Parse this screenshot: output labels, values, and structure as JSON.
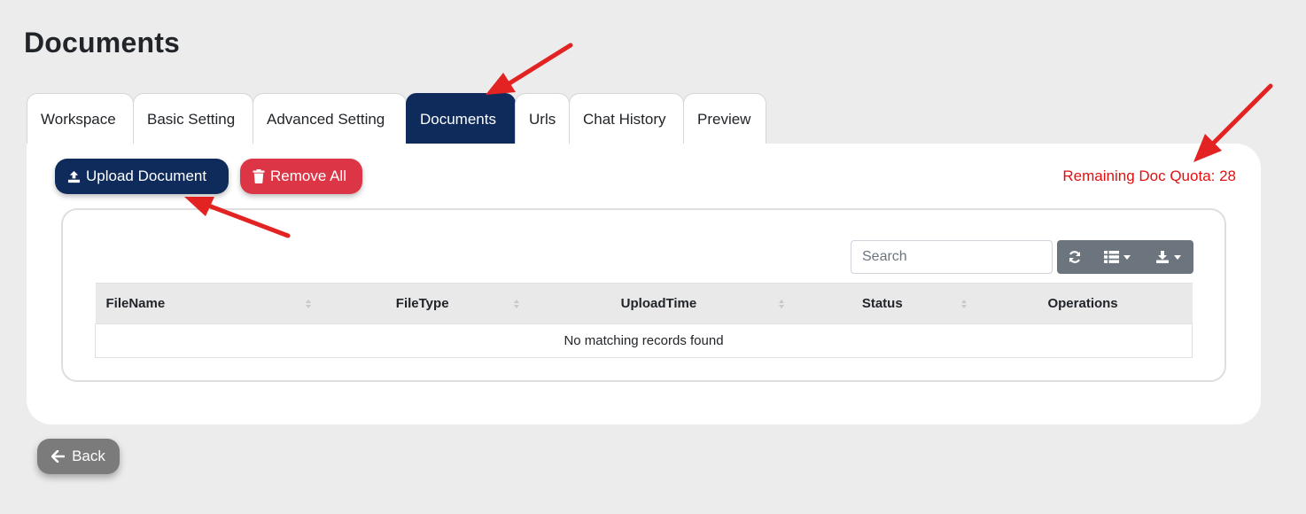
{
  "page": {
    "title": "Documents"
  },
  "tabs": [
    {
      "label": "Workspace",
      "active": false
    },
    {
      "label": "Basic Setting",
      "active": false
    },
    {
      "label": "Advanced Setting",
      "active": false
    },
    {
      "label": "Documents",
      "active": true
    },
    {
      "label": "Urls",
      "active": false
    },
    {
      "label": "Chat History",
      "active": false
    },
    {
      "label": "Preview",
      "active": false
    }
  ],
  "toolbar": {
    "upload_label": "Upload Document",
    "upload_icon": "upload-icon",
    "remove_label": "Remove All",
    "remove_icon": "trash-icon",
    "quota_text": "Remaining Doc Quota: 28"
  },
  "table": {
    "search_placeholder": "Search",
    "tools": [
      "refresh-icon",
      "columns-icon",
      "export-icon"
    ],
    "columns": [
      "FileName",
      "FileType",
      "UploadTime",
      "Status",
      "Operations"
    ],
    "empty_message": "No matching records found"
  },
  "footer": {
    "back_label": "Back",
    "back_icon": "arrow-left-icon"
  },
  "colors": {
    "primary": "#0f2b5b",
    "danger": "#dc3545",
    "quota_text": "#e01010",
    "annotation_arrow": "#e32222",
    "secondary": "#6c757d"
  }
}
